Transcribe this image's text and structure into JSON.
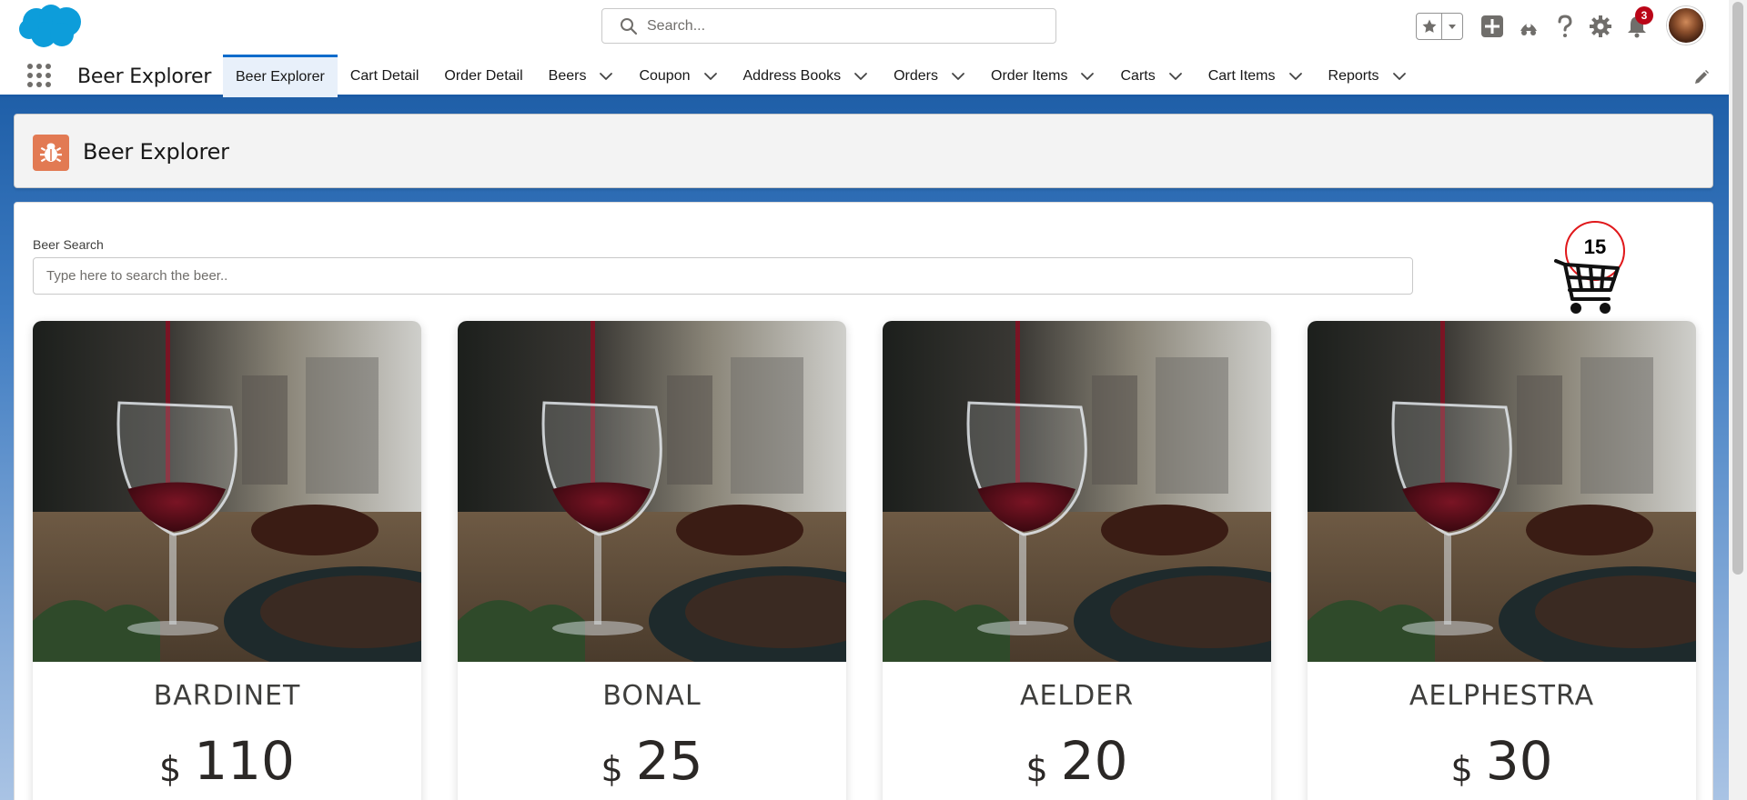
{
  "global_header": {
    "search_placeholder": "Search...",
    "notification_count": "3"
  },
  "nav": {
    "app_name": "Beer Explorer",
    "items": [
      {
        "label": "Beer Explorer",
        "has_menu": false,
        "active": true
      },
      {
        "label": "Cart Detail",
        "has_menu": false,
        "active": false
      },
      {
        "label": "Order Detail",
        "has_menu": false,
        "active": false
      },
      {
        "label": "Beers",
        "has_menu": true,
        "active": false
      },
      {
        "label": "Coupon",
        "has_menu": true,
        "active": false
      },
      {
        "label": "Address Books",
        "has_menu": true,
        "active": false
      },
      {
        "label": "Orders",
        "has_menu": true,
        "active": false
      },
      {
        "label": "Order Items",
        "has_menu": true,
        "active": false
      },
      {
        "label": "Carts",
        "has_menu": true,
        "active": false
      },
      {
        "label": "Cart Items",
        "has_menu": true,
        "active": false
      },
      {
        "label": "Reports",
        "has_menu": true,
        "active": false
      }
    ]
  },
  "page_header": {
    "title": "Beer Explorer"
  },
  "search": {
    "label": "Beer Search",
    "placeholder": "Type here to search the beer.."
  },
  "cart": {
    "count": "15"
  },
  "beers": [
    {
      "name": "BARDINET",
      "currency": "$",
      "price": "110"
    },
    {
      "name": "BONAL",
      "currency": "$",
      "price": "25"
    },
    {
      "name": "AELDER",
      "currency": "$",
      "price": "20"
    },
    {
      "name": "AELPHESTRA",
      "currency": "$",
      "price": "30"
    }
  ],
  "colors": {
    "brand_blue": "#1b5ba5",
    "active_tab_bg": "#e8f0fa",
    "page_icon": "#e27a53",
    "cart_circle": "#e0181b",
    "notification_badge": "#ba0517"
  },
  "icons": {
    "logo": "salesforce-cloud-logo",
    "page": "bug-icon",
    "cart": "shopping-cart-icon"
  }
}
